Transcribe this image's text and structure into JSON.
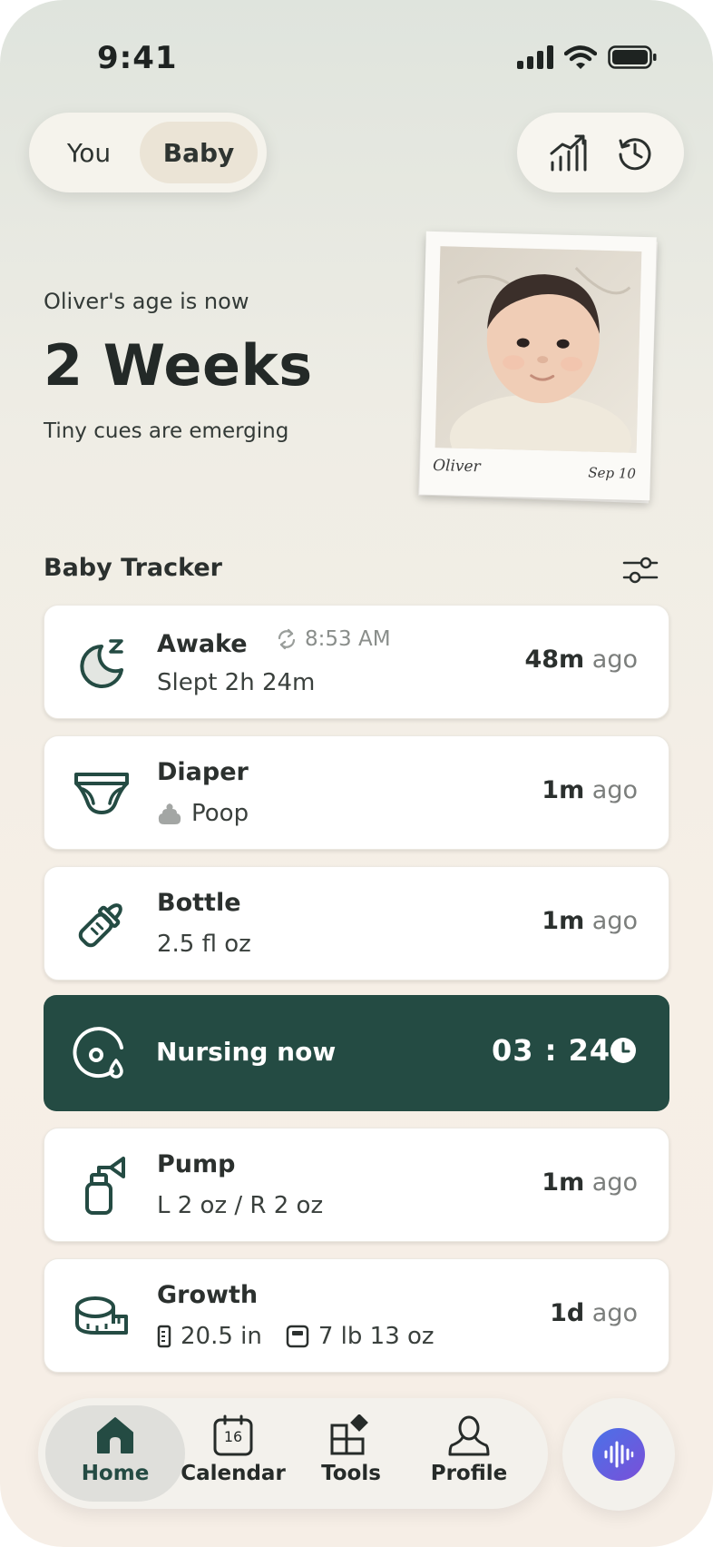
{
  "status_bar": {
    "time": "9:41"
  },
  "toggle": {
    "you_label": "You",
    "baby_label": "Baby",
    "selected": "Baby"
  },
  "header_tools": {
    "chart_icon": "chart-up-icon",
    "history_icon": "history-icon"
  },
  "hero": {
    "age_prefix": "Oliver's age is now",
    "age_value": "2 Weeks",
    "subtitle": "Tiny cues are emerging",
    "photo_caption_name": "Oliver",
    "photo_caption_date": "Sep 10"
  },
  "tracker": {
    "title": "Baby Tracker",
    "items": [
      {
        "icon": "moon-icon",
        "title": "Awake",
        "time_chip": "8:53 AM",
        "detail": "Slept 2h 24m",
        "ago_value": "48m",
        "ago_label": "ago"
      },
      {
        "icon": "diaper-icon",
        "title": "Diaper",
        "detail": "Poop",
        "ago_value": "1m",
        "ago_label": "ago"
      },
      {
        "icon": "bottle-icon",
        "title": "Bottle",
        "detail": "2.5 fl oz",
        "ago_value": "1m",
        "ago_label": "ago"
      },
      {
        "icon": "pump-icon",
        "title": "Pump",
        "detail": "L 2 oz / R 2 oz",
        "ago_value": "1m",
        "ago_label": "ago"
      },
      {
        "icon": "tape-measure-icon",
        "title": "Growth",
        "length": "20.5 in",
        "weight": "7 lb 13 oz",
        "ago_value": "1d",
        "ago_label": "ago"
      }
    ],
    "nursing": {
      "icon": "nursing-icon",
      "title": "Nursing now",
      "timer": "03 : 24"
    }
  },
  "nav": {
    "tabs": [
      {
        "label": "Home",
        "icon": "home-icon",
        "active": true
      },
      {
        "label": "Calendar",
        "icon": "calendar-icon",
        "badge": "16"
      },
      {
        "label": "Tools",
        "icon": "tools-icon"
      },
      {
        "label": "Profile",
        "icon": "profile-icon"
      }
    ],
    "voice_icon": "voice-wave-icon"
  },
  "colors": {
    "accent": "#244b43",
    "background_top": "#dfe4dd",
    "background_bottom": "#f6eee6"
  }
}
